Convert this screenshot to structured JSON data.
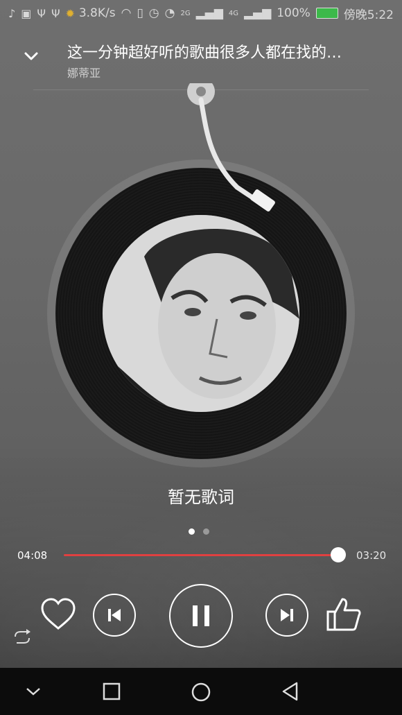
{
  "status_bar": {
    "speed": "3.8K/s",
    "network_a": "2G",
    "network_b": "4G",
    "battery": "100%",
    "time": "傍晚5:22"
  },
  "song": {
    "title": "这一分钟超好听的歌曲很多人都在找的…",
    "artist": "娜蒂亚"
  },
  "lyrics": {
    "text": "暂无歌词"
  },
  "page_indicator": {
    "count": 2,
    "active_index": 0
  },
  "progress": {
    "current_time": "04:08",
    "total_time": "03:20",
    "fraction": 1.0
  },
  "colors": {
    "accent": "#e04040",
    "battery": "#3cb94a"
  },
  "icons": {
    "collapse": "chevron-down-icon",
    "favorite": "heart-icon",
    "previous": "skip-previous-icon",
    "play_pause": "pause-icon",
    "next": "skip-next-icon",
    "like": "thumbs-up-icon",
    "repeat": "repeat-icon"
  }
}
